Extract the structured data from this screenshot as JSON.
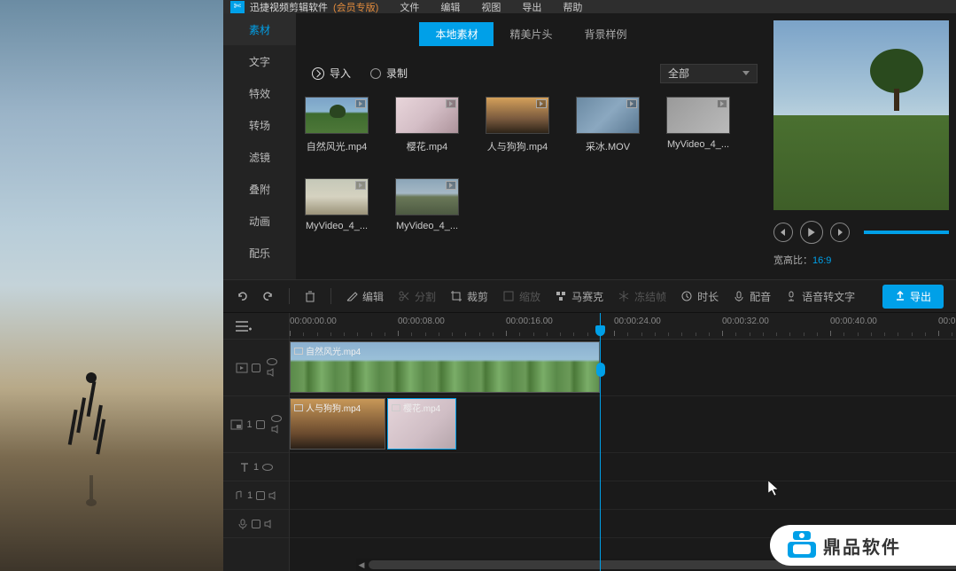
{
  "title": {
    "app": "迅捷视频剪辑软件",
    "member": "(会员专版)",
    "icon": "✄"
  },
  "menu": [
    "文件",
    "编辑",
    "视图",
    "导出",
    "帮助"
  ],
  "leftTabs": [
    "素材",
    "文字",
    "特效",
    "转场",
    "滤镜",
    "叠附",
    "动画",
    "配乐"
  ],
  "subTabs": [
    "本地素材",
    "精美片头",
    "背景样例"
  ],
  "importLabel": "导入",
  "recordLabel": "录制",
  "dropdown": "全部",
  "clips": [
    {
      "name": "自然风光.mp4",
      "thumb": "th-nature"
    },
    {
      "name": "樱花.mp4",
      "thumb": "th-sakura"
    },
    {
      "name": "人与狗狗.mp4",
      "thumb": "th-person"
    },
    {
      "name": "采冰.MOV",
      "thumb": "th-ice"
    },
    {
      "name": "MyVideo_4_...",
      "thumb": "th-gray"
    },
    {
      "name": "MyVideo_4_...",
      "thumb": "th-field"
    },
    {
      "name": "MyVideo_4_...",
      "thumb": "th-road"
    }
  ],
  "aspectLabel": "宽高比：",
  "aspectValue": "16:9",
  "toolbar": {
    "edit": "编辑",
    "split": "分割",
    "crop": "裁剪",
    "zoom": "缩放",
    "mosaic": "马赛克",
    "freeze": "冻结帧",
    "duration": "时长",
    "voiceover": "配音",
    "speech": "语音转文字",
    "export": "导出"
  },
  "ruler": [
    "00:00:00.00",
    "00:00:08.00",
    "00:00:16.00",
    "00:00:24.00",
    "00:00:32.00",
    "00:00:40.00",
    "00:0"
  ],
  "tlClips": {
    "main": "自然风光.mp4",
    "sub1": "人与狗狗.mp4",
    "sub2": "樱花.mp4"
  },
  "trackNum": "1",
  "watermark": "鼎品软件"
}
